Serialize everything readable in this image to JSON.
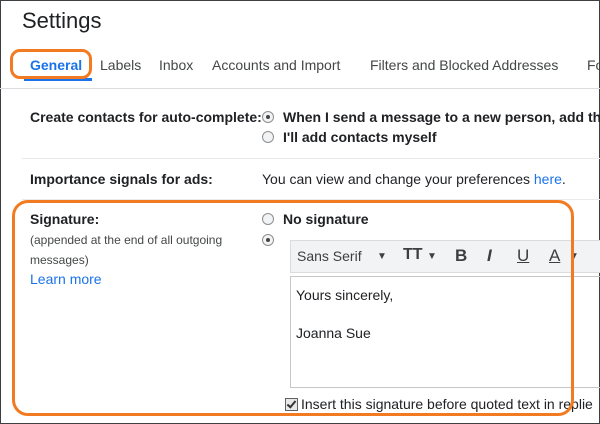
{
  "page": {
    "title": "Settings"
  },
  "tabs": [
    {
      "label": "General"
    },
    {
      "label": "Labels"
    },
    {
      "label": "Inbox"
    },
    {
      "label": "Accounts and Import"
    },
    {
      "label": "Filters and Blocked Addresses"
    },
    {
      "label": "Fo"
    }
  ],
  "contacts": {
    "label": "Create contacts for auto-complete:",
    "option1": "When I send a message to a new person, add the",
    "option2": "I'll add contacts myself"
  },
  "importance": {
    "label": "Importance signals for ads:",
    "text": "You can view and change your preferences",
    "link": "here",
    "period": "."
  },
  "signature": {
    "label": "Signature:",
    "sub1": "(appended at the end of all outgoing",
    "sub2": "messages)",
    "learn_more": "Learn more",
    "no_signature": "No signature",
    "font": "Sans Serif",
    "line1": "Yours sincerely,",
    "line2": "Joanna Sue",
    "insert_label": "Insert this signature before quoted text in replie"
  },
  "colors": {
    "accent": "#1a73e8",
    "highlight": "#f27b21"
  }
}
